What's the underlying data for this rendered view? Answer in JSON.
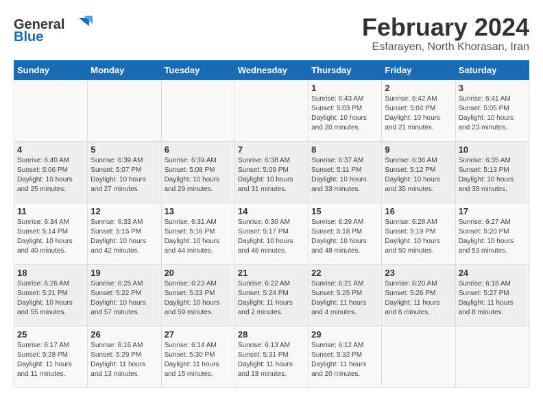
{
  "logo": {
    "line1": "General",
    "line2": "Blue"
  },
  "title": "February 2024",
  "subtitle": "Esfarayen, North Khorasan, Iran",
  "weekdays": [
    "Sunday",
    "Monday",
    "Tuesday",
    "Wednesday",
    "Thursday",
    "Friday",
    "Saturday"
  ],
  "weeks": [
    [
      {
        "day": "",
        "info": ""
      },
      {
        "day": "",
        "info": ""
      },
      {
        "day": "",
        "info": ""
      },
      {
        "day": "",
        "info": ""
      },
      {
        "day": "1",
        "info": "Sunrise: 6:43 AM\nSunset: 5:03 PM\nDaylight: 10 hours\nand 20 minutes."
      },
      {
        "day": "2",
        "info": "Sunrise: 6:42 AM\nSunset: 5:04 PM\nDaylight: 10 hours\nand 21 minutes."
      },
      {
        "day": "3",
        "info": "Sunrise: 6:41 AM\nSunset: 5:05 PM\nDaylight: 10 hours\nand 23 minutes."
      }
    ],
    [
      {
        "day": "4",
        "info": "Sunrise: 6:40 AM\nSunset: 5:06 PM\nDaylight: 10 hours\nand 25 minutes."
      },
      {
        "day": "5",
        "info": "Sunrise: 6:39 AM\nSunset: 5:07 PM\nDaylight: 10 hours\nand 27 minutes."
      },
      {
        "day": "6",
        "info": "Sunrise: 6:39 AM\nSunset: 5:08 PM\nDaylight: 10 hours\nand 29 minutes."
      },
      {
        "day": "7",
        "info": "Sunrise: 6:38 AM\nSunset: 5:09 PM\nDaylight: 10 hours\nand 31 minutes."
      },
      {
        "day": "8",
        "info": "Sunrise: 6:37 AM\nSunset: 5:11 PM\nDaylight: 10 hours\nand 33 minutes."
      },
      {
        "day": "9",
        "info": "Sunrise: 6:36 AM\nSunset: 5:12 PM\nDaylight: 10 hours\nand 35 minutes."
      },
      {
        "day": "10",
        "info": "Sunrise: 6:35 AM\nSunset: 5:13 PM\nDaylight: 10 hours\nand 38 minutes."
      }
    ],
    [
      {
        "day": "11",
        "info": "Sunrise: 6:34 AM\nSunset: 5:14 PM\nDaylight: 10 hours\nand 40 minutes."
      },
      {
        "day": "12",
        "info": "Sunrise: 6:33 AM\nSunset: 5:15 PM\nDaylight: 10 hours\nand 42 minutes."
      },
      {
        "day": "13",
        "info": "Sunrise: 6:31 AM\nSunset: 5:16 PM\nDaylight: 10 hours\nand 44 minutes."
      },
      {
        "day": "14",
        "info": "Sunrise: 6:30 AM\nSunset: 5:17 PM\nDaylight: 10 hours\nand 46 minutes."
      },
      {
        "day": "15",
        "info": "Sunrise: 6:29 AM\nSunset: 5:18 PM\nDaylight: 10 hours\nand 48 minutes."
      },
      {
        "day": "16",
        "info": "Sunrise: 6:28 AM\nSunset: 5:19 PM\nDaylight: 10 hours\nand 50 minutes."
      },
      {
        "day": "17",
        "info": "Sunrise: 6:27 AM\nSunset: 5:20 PM\nDaylight: 10 hours\nand 53 minutes."
      }
    ],
    [
      {
        "day": "18",
        "info": "Sunrise: 6:26 AM\nSunset: 5:21 PM\nDaylight: 10 hours\nand 55 minutes."
      },
      {
        "day": "19",
        "info": "Sunrise: 6:25 AM\nSunset: 5:22 PM\nDaylight: 10 hours\nand 57 minutes."
      },
      {
        "day": "20",
        "info": "Sunrise: 6:23 AM\nSunset: 5:23 PM\nDaylight: 10 hours\nand 59 minutes."
      },
      {
        "day": "21",
        "info": "Sunrise: 6:22 AM\nSunset: 5:24 PM\nDaylight: 11 hours\nand 2 minutes."
      },
      {
        "day": "22",
        "info": "Sunrise: 6:21 AM\nSunset: 5:25 PM\nDaylight: 11 hours\nand 4 minutes."
      },
      {
        "day": "23",
        "info": "Sunrise: 6:20 AM\nSunset: 5:26 PM\nDaylight: 11 hours\nand 6 minutes."
      },
      {
        "day": "24",
        "info": "Sunrise: 6:18 AM\nSunset: 5:27 PM\nDaylight: 11 hours\nand 8 minutes."
      }
    ],
    [
      {
        "day": "25",
        "info": "Sunrise: 6:17 AM\nSunset: 5:28 PM\nDaylight: 11 hours\nand 11 minutes."
      },
      {
        "day": "26",
        "info": "Sunrise: 6:16 AM\nSunset: 5:29 PM\nDaylight: 11 hours\nand 13 minutes."
      },
      {
        "day": "27",
        "info": "Sunrise: 6:14 AM\nSunset: 5:30 PM\nDaylight: 11 hours\nand 15 minutes."
      },
      {
        "day": "28",
        "info": "Sunrise: 6:13 AM\nSunset: 5:31 PM\nDaylight: 11 hours\nand 18 minutes."
      },
      {
        "day": "29",
        "info": "Sunrise: 6:12 AM\nSunset: 5:32 PM\nDaylight: 11 hours\nand 20 minutes."
      },
      {
        "day": "",
        "info": ""
      },
      {
        "day": "",
        "info": ""
      }
    ]
  ]
}
